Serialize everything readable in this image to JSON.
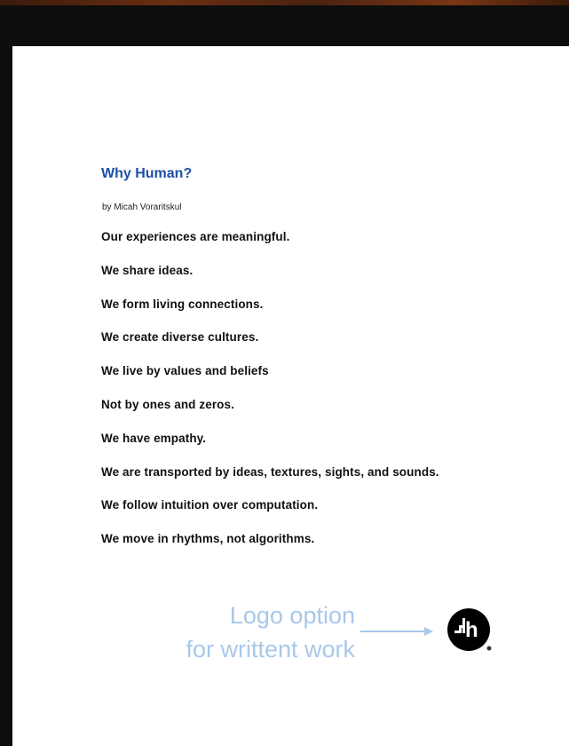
{
  "document": {
    "title": "Why Human?",
    "author": "by Micah Voraritskul",
    "lines": [
      "Our experiences are meaningful.",
      "We share ideas.",
      "We form living connections.",
      "We create diverse cultures.",
      "We live by values and beliefs",
      "Not by ones and zeros.",
      "We have empathy.",
      "We are transported by ideas, textures, sights, and sounds.",
      "We follow intuition over computation.",
      "We move in rhythms, not algorithms."
    ]
  },
  "annotation": {
    "line1": "Logo option",
    "line2": "for writtent work"
  },
  "logo": {
    "text": "h"
  },
  "colors": {
    "title": "#1d4fa8",
    "annotation": "#a9c8ea",
    "logo": "#000000",
    "background": "#0d0d0d"
  }
}
